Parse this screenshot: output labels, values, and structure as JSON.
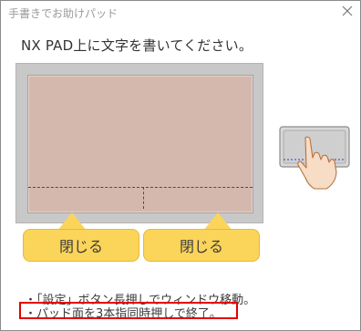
{
  "window": {
    "title": "手書きでお助けパッド"
  },
  "header": {
    "instruction": "NX PAD上に文字を書いてください。"
  },
  "pad": {
    "buttons": [
      {
        "label": "閉じる"
      },
      {
        "label": "閉じる"
      }
    ]
  },
  "notes": [
    "・「設定」ボタン長押しでウィンドウ移動。",
    "・パッド面を3本指同時押しで終了。"
  ],
  "icons": {
    "close": "close-icon",
    "hint": "hand-touch-icon"
  },
  "colors": {
    "pad_surface": "#d5b8ad",
    "pad_frame": "#c8c8c8",
    "button": "#fbd45a",
    "guide_line": "#3a3ad8",
    "highlight": "#e40000"
  }
}
